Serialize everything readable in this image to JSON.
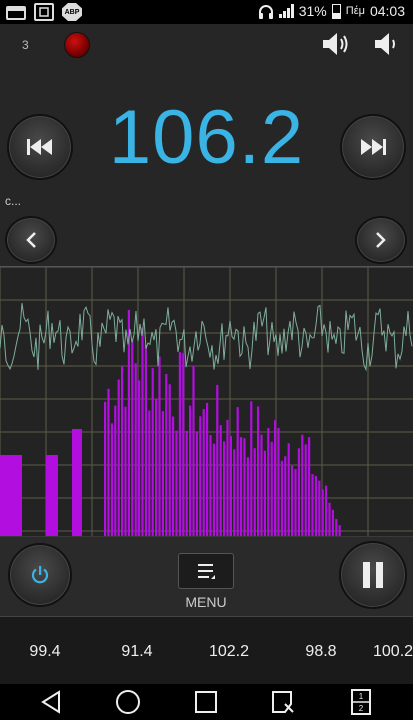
{
  "status_bar": {
    "battery_percent": "31%",
    "day": "Πέμ",
    "time": "04:03",
    "icons": [
      "notification-icon",
      "screenshot-icon",
      "adblock-icon",
      "headphones-icon",
      "signal-icon",
      "battery-icon"
    ],
    "adblock_label": "ABP"
  },
  "radio": {
    "preset_number": "3",
    "frequency": "106.2",
    "station_name": "c...",
    "accent_color": "#39b4e4",
    "spectrum_color": "#b30ee0"
  },
  "controls": {
    "menu_label": "MENU"
  },
  "presets": [
    "99.4",
    "91.4",
    "102.2",
    "98.8",
    "100.2"
  ]
}
